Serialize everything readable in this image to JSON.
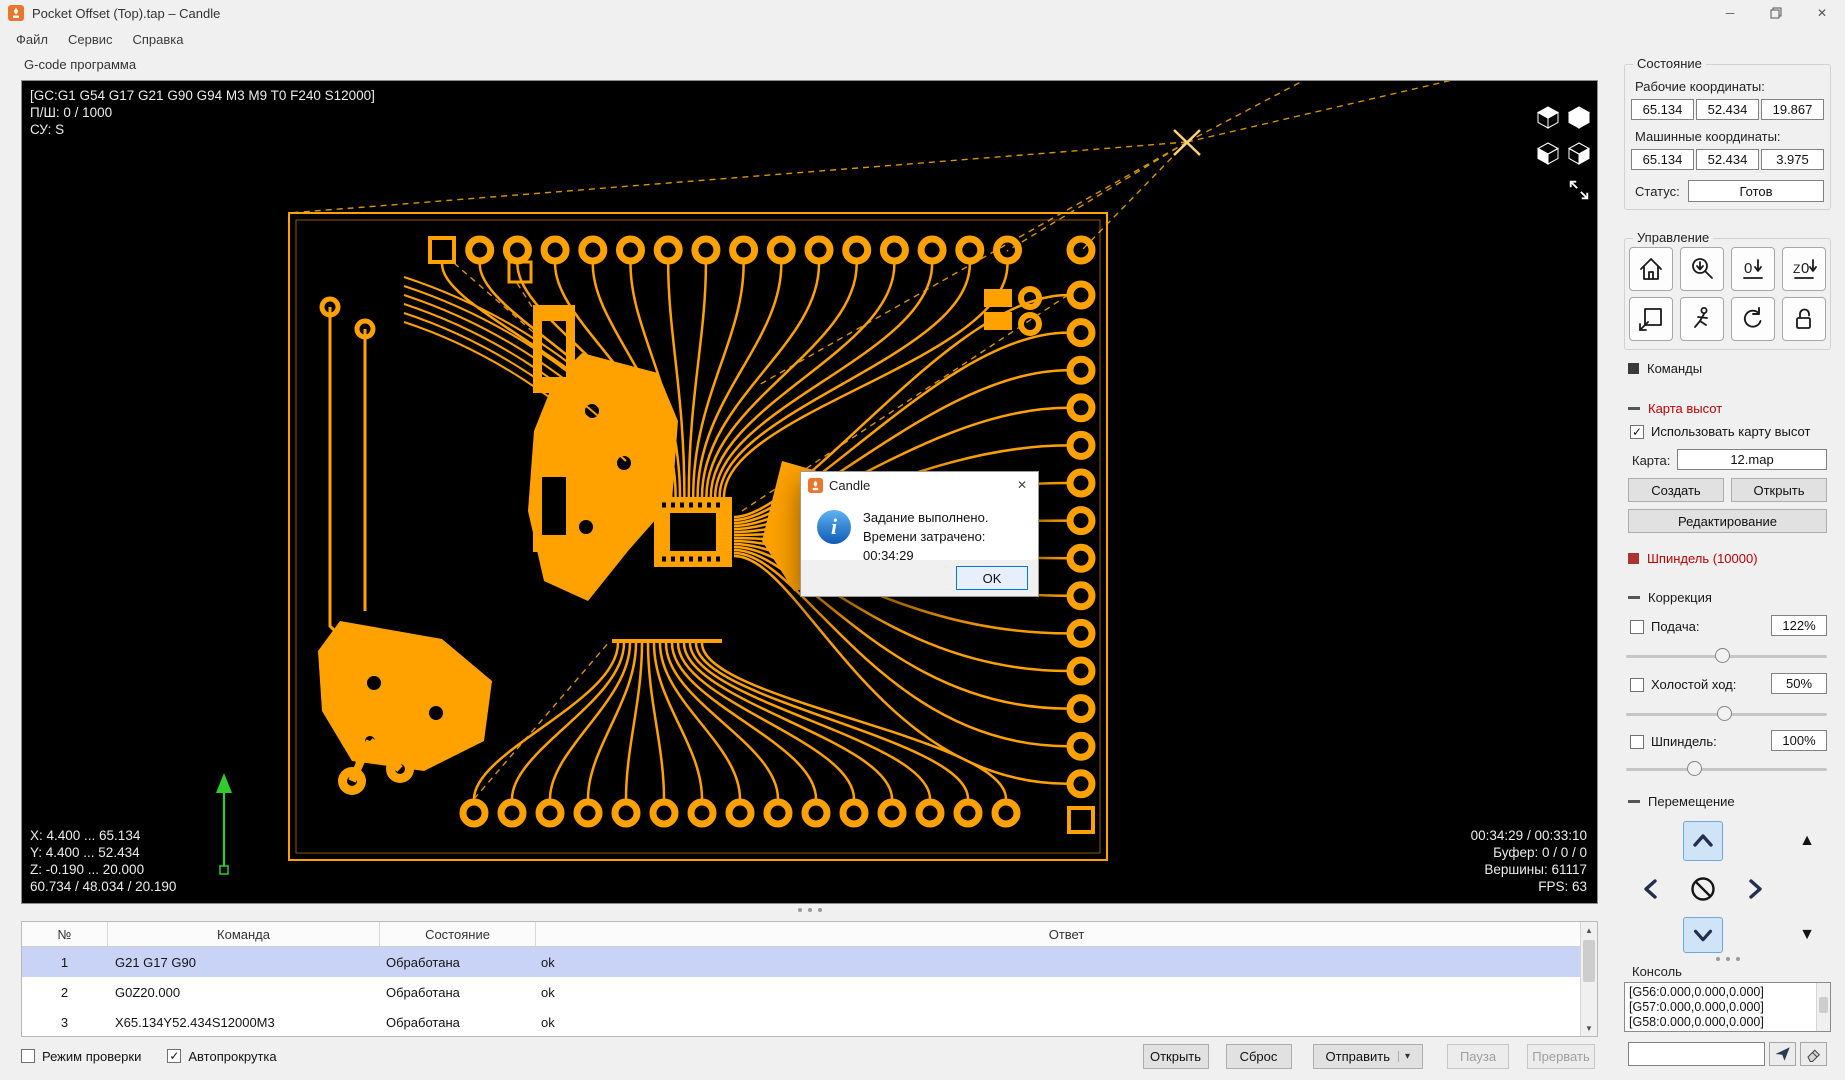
{
  "window": {
    "title": "Pocket Offset (Top).tap – Candle",
    "menu": [
      "Файл",
      "Сервис",
      "Справка"
    ]
  },
  "icons": {
    "minimize": "─",
    "close": "✕",
    "check": "✓",
    "dropdown": "▾",
    "scroll_up": "▲",
    "scroll_down": "▼",
    "jog_z_up": "▲",
    "jog_z_down": "▼"
  },
  "visualizer": {
    "group_title": "G-code программа",
    "overlay_top": {
      "line1": "[GC:G1 G54 G17 G21 G90 G94 M3 M9 T0 F240 S12000]",
      "line2": "П/Ш: 0 / 1000",
      "line3": "СУ: S"
    },
    "overlay_bottom_left": {
      "x_range": "X: 4.400 ... 65.134",
      "y_range": "Y: 4.400 ... 52.434",
      "z_range": "Z: -0.190 ... 20.000",
      "dimensions": "60.734 / 48.034 / 20.190"
    },
    "overlay_bottom_right": {
      "time": "00:34:29 / 00:33:10",
      "buffer": "Буфер: 0 / 0 / 0",
      "vertices": "Вершины: 61117",
      "fps": "FPS: 63"
    }
  },
  "dialog": {
    "title": "Candle",
    "message_line1": "Задание выполнено.",
    "message_line2": "Времени затрачено: 00:34:29",
    "ok_label": "OK"
  },
  "table": {
    "headers": [
      "№",
      "Команда",
      "Состояние",
      "Ответ"
    ],
    "rows": [
      {
        "num": "1",
        "command": "G21 G17 G90",
        "state": "Обработана",
        "response": "ok"
      },
      {
        "num": "2",
        "command": "G0Z20.000",
        "state": "Обработана",
        "response": "ok"
      },
      {
        "num": "3",
        "command": "X65.134Y52.434S12000M3",
        "state": "Обработана",
        "response": "ok"
      }
    ]
  },
  "bottom_bar": {
    "check_mode_label": "Режим проверки",
    "autoscroll_label": "Автопрокрутка",
    "open_label": "Открыть",
    "reset_label": "Сброс",
    "send_label": "Отправить",
    "pause_label": "Пауза",
    "abort_label": "Прервать"
  },
  "sidebar": {
    "state": {
      "title": "Состояние",
      "work_label": "Рабочие координаты:",
      "work_coords": [
        "65.134",
        "52.434",
        "19.867"
      ],
      "machine_label": "Машинные координаты:",
      "machine_coords": [
        "65.134",
        "52.434",
        "3.975"
      ],
      "status_label": "Статус:",
      "status_value": "Готов"
    },
    "control": {
      "title": "Управление"
    },
    "commands": {
      "title": "Команды"
    },
    "heightmap": {
      "title": "Карта высот",
      "use_label": "Использовать карту высот",
      "map_label": "Карта:",
      "map_value": "12.map",
      "create_label": "Создать",
      "open_label": "Открыть",
      "edit_label": "Редактирование"
    },
    "spindle": {
      "title": "Шпиндель (10000)"
    },
    "override": {
      "title": "Коррекция",
      "feed_label": "Подача:",
      "feed_value": "122%",
      "feed_pos": 48,
      "rapid_label": "Холостой ход:",
      "rapid_value": "50%",
      "rapid_pos": 49,
      "spindle_label": "Шпиндель:",
      "spindle_value": "100%",
      "spindle_pos": 34
    },
    "jog": {
      "title": "Перемещение"
    },
    "console": {
      "title": "Консоль",
      "lines": [
        "[G56:0.000,0.000,0.000]",
        "[G57:0.000,0.000,0.000]",
        "[G58:0.000,0.000,0.000]"
      ]
    }
  }
}
